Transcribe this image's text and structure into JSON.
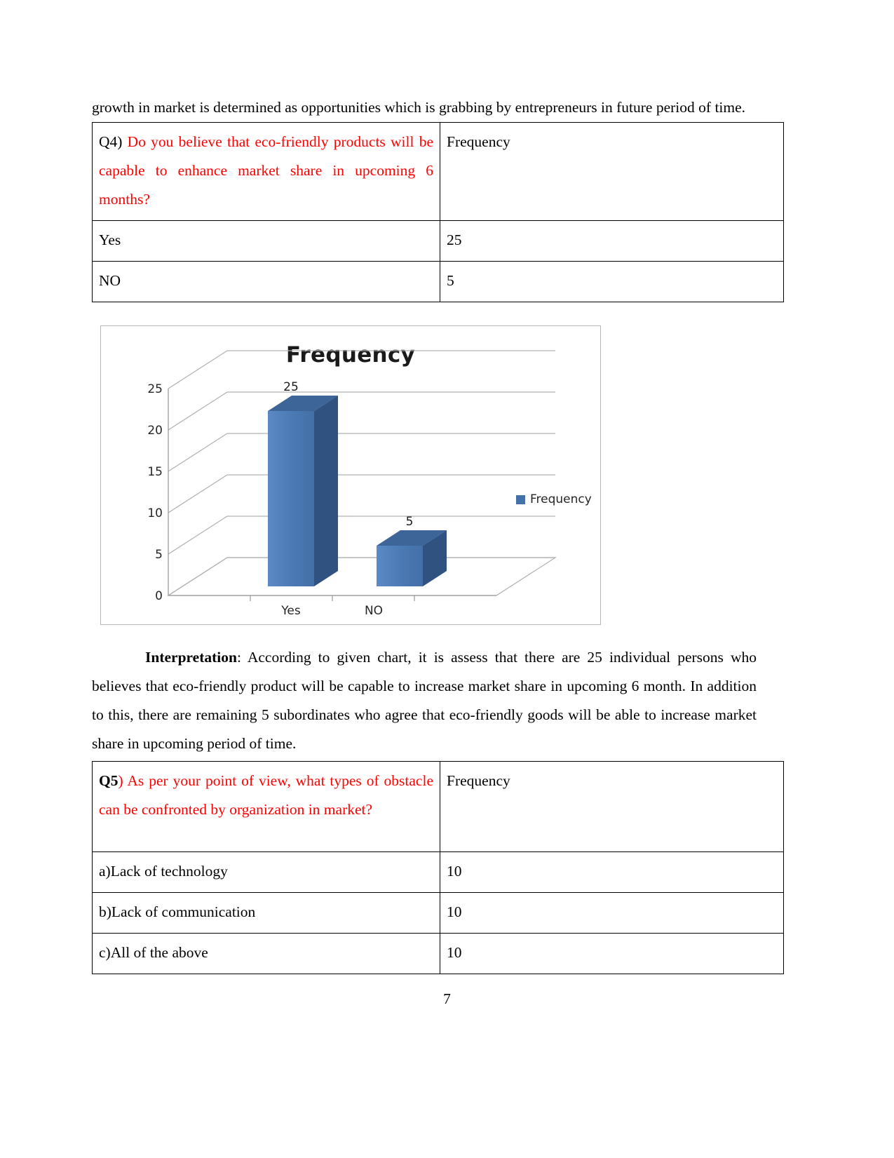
{
  "document": {
    "page_number": "7",
    "intro_paragraph": "growth in market is determined as opportunities which is grabbing by entrepreneurs in future period of time."
  },
  "table_q4": {
    "question_prefix": "Q4)",
    "question_text": " Do you believe that eco-friendly products will be capable to enhance market share in upcoming 6 months?",
    "frequency_header": "Frequency",
    "rows": [
      {
        "label": "Yes",
        "value": "25"
      },
      {
        "label": "NO",
        "value": "5"
      }
    ]
  },
  "chart": {
    "title": "Frequency",
    "legend_label": "Frequency",
    "series_color": "#4472a8",
    "y_ticks": [
      "0",
      "5",
      "10",
      "15",
      "20",
      "25"
    ],
    "x_labels": [
      "Yes",
      "NO"
    ],
    "data_labels": [
      "25",
      "5"
    ]
  },
  "chart_data": {
    "type": "bar",
    "title": "Frequency",
    "categories": [
      "Yes",
      "NO"
    ],
    "values": [
      25,
      5
    ],
    "series": [
      {
        "name": "Frequency",
        "values": [
          25,
          5
        ]
      }
    ],
    "xlabel": "",
    "ylabel": "",
    "ylim": [
      0,
      25
    ],
    "ytick_step": 5,
    "grid": true,
    "legend_position": "right",
    "style": "3d-column"
  },
  "interpretation": {
    "label": "Interpretation",
    "separator": ": ",
    "text": "According to given chart, it is assess that there are 25 individual persons who believes that eco-friendly product will be capable to increase market share in upcoming 6 month. In addition to this, there are remaining 5 subordinates who agree that eco-friendly goods will be able to increase market share in upcoming period of time."
  },
  "table_q5": {
    "question_prefix": "Q5",
    "question_paren": ")",
    "question_text": " As per your point of view, what types of obstacle can be confronted by organization in market?",
    "frequency_header": "Frequency",
    "rows": [
      {
        "label": "a)Lack of technology",
        "value": "10"
      },
      {
        "label": "b)Lack of communication",
        "value": "10"
      },
      {
        "label": "c)All of the above",
        "value": "10"
      }
    ]
  }
}
